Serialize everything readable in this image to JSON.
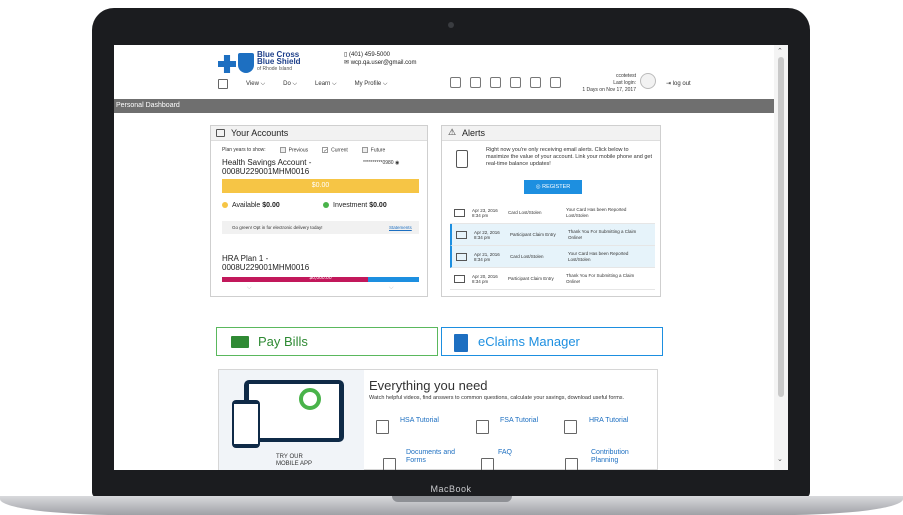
{
  "device": {
    "label": "MacBook"
  },
  "header": {
    "brand_line1": "Blue Cross",
    "brand_line2": "Blue Shield",
    "brand_line3": "of Rhode Island",
    "phone": "(401) 459-5000",
    "email": "wcp.qa.user@gmail.com",
    "nav": [
      "View",
      "Do",
      "Learn",
      "My Profile"
    ],
    "username": "ccotetest",
    "last_login_label": "Last login:",
    "last_login": "1 Days on Nov 17, 2017",
    "logout": "log out"
  },
  "dashboard_bar": "Personal Dashboard",
  "accounts": {
    "title": "Your Accounts",
    "plan_years_label": "Plan years to show:",
    "plan_previous": "Previous",
    "plan_current": "Current",
    "plan_future": "Future",
    "hsa_title": "Health Savings Account -",
    "hsa_id": "0008U229001MHM0016",
    "masked_number": "**********0980",
    "hsa_balance": "$0.00",
    "available_label": "Available",
    "available_value": "$0.00",
    "investment_label": "Investment",
    "investment_value": "$0.00",
    "paperless": "Go green! Opt in for electronic delivery today!",
    "statements": "Statements",
    "hra_title": "HRA Plan 1 -",
    "hra_id": "0008U229001MHM0016",
    "hra_balance": "$0,000.00"
  },
  "alerts": {
    "title": "Alerts",
    "message": "Right now you're only receiving email alerts. Click below to maximize the value of your account. Link your mobile phone and get real-time balance updates!",
    "register": "REGISTER",
    "rows": [
      {
        "date": "Apr 23, 2016",
        "time": "8:34 pm",
        "type": "Card Lost/Stolen",
        "message": "Your Card Has been Reported Lost/Stolen"
      },
      {
        "date": "Apr 22, 2016",
        "time": "8:34 pm",
        "type": "Participant Claim Entry",
        "message": "Thank You For Submitting a Claim Online!"
      },
      {
        "date": "Apr 21, 2016",
        "time": "8:34 pm",
        "type": "Card Lost/Stolen",
        "message": "Your Card Has been Reported Lost/Stolen"
      },
      {
        "date": "Apr 20, 2016",
        "time": "8:34 pm",
        "type": "Participant Claim Entry",
        "message": "Thank You For Submitting a Claim Online!"
      }
    ]
  },
  "actions": {
    "pay_bills": "Pay Bills",
    "eclaims": "eClaims Manager"
  },
  "everything": {
    "title": "Everything you need",
    "subtitle": "Watch helpful videos, find answers to common questions, calculate your savings, download useful forms.",
    "try_app_1": "TRY OUR",
    "try_app_2": "MOBILE APP",
    "links": [
      "HSA Tutorial",
      "FSA Tutorial",
      "HRA Tutorial",
      "Documents and Forms",
      "FAQ",
      "Contribution Planning"
    ]
  }
}
